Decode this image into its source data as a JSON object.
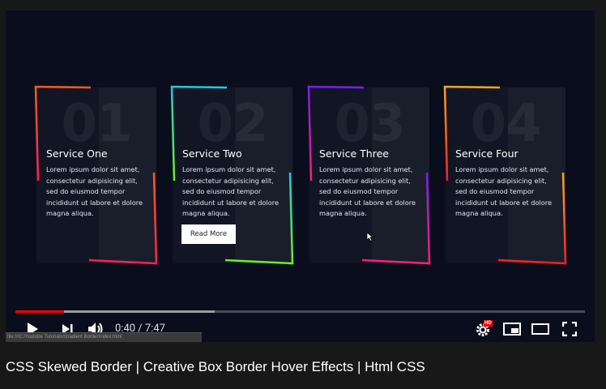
{
  "video": {
    "cards": [
      {
        "number": "01",
        "title": "Service One",
        "text": "Lorem ipsum dolor sit amet, consectetur adipisicing elit, sed do eiusmod tempor incididunt ut labore et dolore magna aliqua.",
        "border_top": "#ff5a1e",
        "border_bottom": "#ff1e5a"
      },
      {
        "number": "02",
        "title": "Service Two",
        "text": "Lorem ipsum dolor sit amet, consectetur adipisicing elit, sed do eiusmod tempor incididunt ut labore et dolore magna aliqua.",
        "button_label": "Read More",
        "border_top": "#1ecbe1",
        "border_bottom": "#6af01e"
      },
      {
        "number": "03",
        "title": "Service Three",
        "text": "Lorem ipsum dolor sit amet, consectetur adipisicing elit, sed do eiusmod tempor incididunt ut labore et dolore magna aliqua.",
        "border_top": "#7a1ef0",
        "border_bottom": "#ff1e78"
      },
      {
        "number": "04",
        "title": "Service Four",
        "text": "Lorem ipsum dolor sit amet, consectetur adipisicing elit, sed do eiusmod tempor incididunt ut labore et dolore magna aliqua.",
        "border_top": "#ffa51e",
        "border_bottom": "#ff1e1e"
      }
    ]
  },
  "player": {
    "current_time": "0:40",
    "duration": "7:47",
    "time_display": "0:40 / 7:47",
    "played_fraction": 0.086,
    "buffered_fraction": 0.35,
    "status_url": "file:///C:/Youtube Tutorials/Gradient Border/index.html",
    "hd_badge": "HD",
    "accent_color": "#ff0000"
  },
  "page": {
    "title": "CSS Skewed Border | Creative Box Border Hover Effects | Html CSS"
  }
}
